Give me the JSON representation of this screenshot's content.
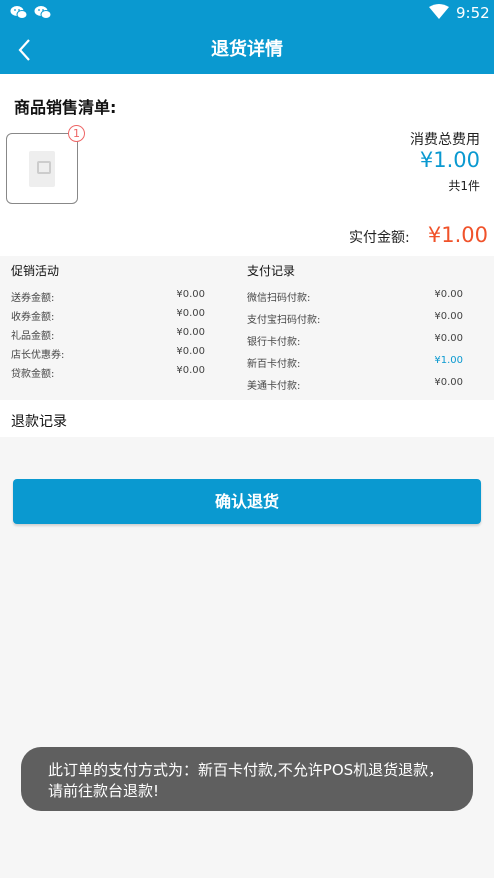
{
  "status_bar": {
    "time": "9:52",
    "notification_icons": [
      "wechat-icon",
      "wechat-icon"
    ],
    "wifi_icon": "wifi-icon",
    "battery_icon": "battery-icon"
  },
  "app_bar": {
    "title": "退货详情",
    "back_icon": "back-chevron-icon"
  },
  "order": {
    "list_title": "商品销售清单:",
    "item": {
      "qty_badge": "1",
      "image_icon": "product-placeholder-icon"
    },
    "total_label": "消费总费用",
    "total_value": "¥1.00",
    "count": "共1件",
    "paid_label": "实付金额:",
    "paid_value": "¥1.00"
  },
  "promotions": {
    "title": "促销活动",
    "rows": [
      {
        "label": "送券金额:",
        "value": "¥0.00"
      },
      {
        "label": "收券金额:",
        "value": "¥0.00"
      },
      {
        "label": "礼品金额:",
        "value": "¥0.00"
      },
      {
        "label": "店长优惠券:",
        "value": "¥0.00"
      },
      {
        "label": "贷款金额:",
        "value": "¥0.00"
      }
    ]
  },
  "payments": {
    "title": "支付记录",
    "rows": [
      {
        "label": "微信扫码付款:",
        "value": "¥0.00"
      },
      {
        "label": "支付宝扫码付款:",
        "value": "¥0.00"
      },
      {
        "label": "银行卡付款:",
        "value": "¥0.00"
      },
      {
        "label": "新百卡付款:",
        "value": "¥1.00"
      },
      {
        "label": "美通卡付款:",
        "value": "¥0.00"
      }
    ]
  },
  "refund": {
    "title": "退款记录"
  },
  "confirm_button": {
    "label": "确认退货"
  },
  "toast": {
    "message": "此订单的支付方式为：新百卡付款,不允许POS机退货退款，请前往款台退款!"
  },
  "colors": {
    "primary": "#0a99d0",
    "price_red": "#f0522a",
    "toast_bg": "#5f5f5f"
  }
}
